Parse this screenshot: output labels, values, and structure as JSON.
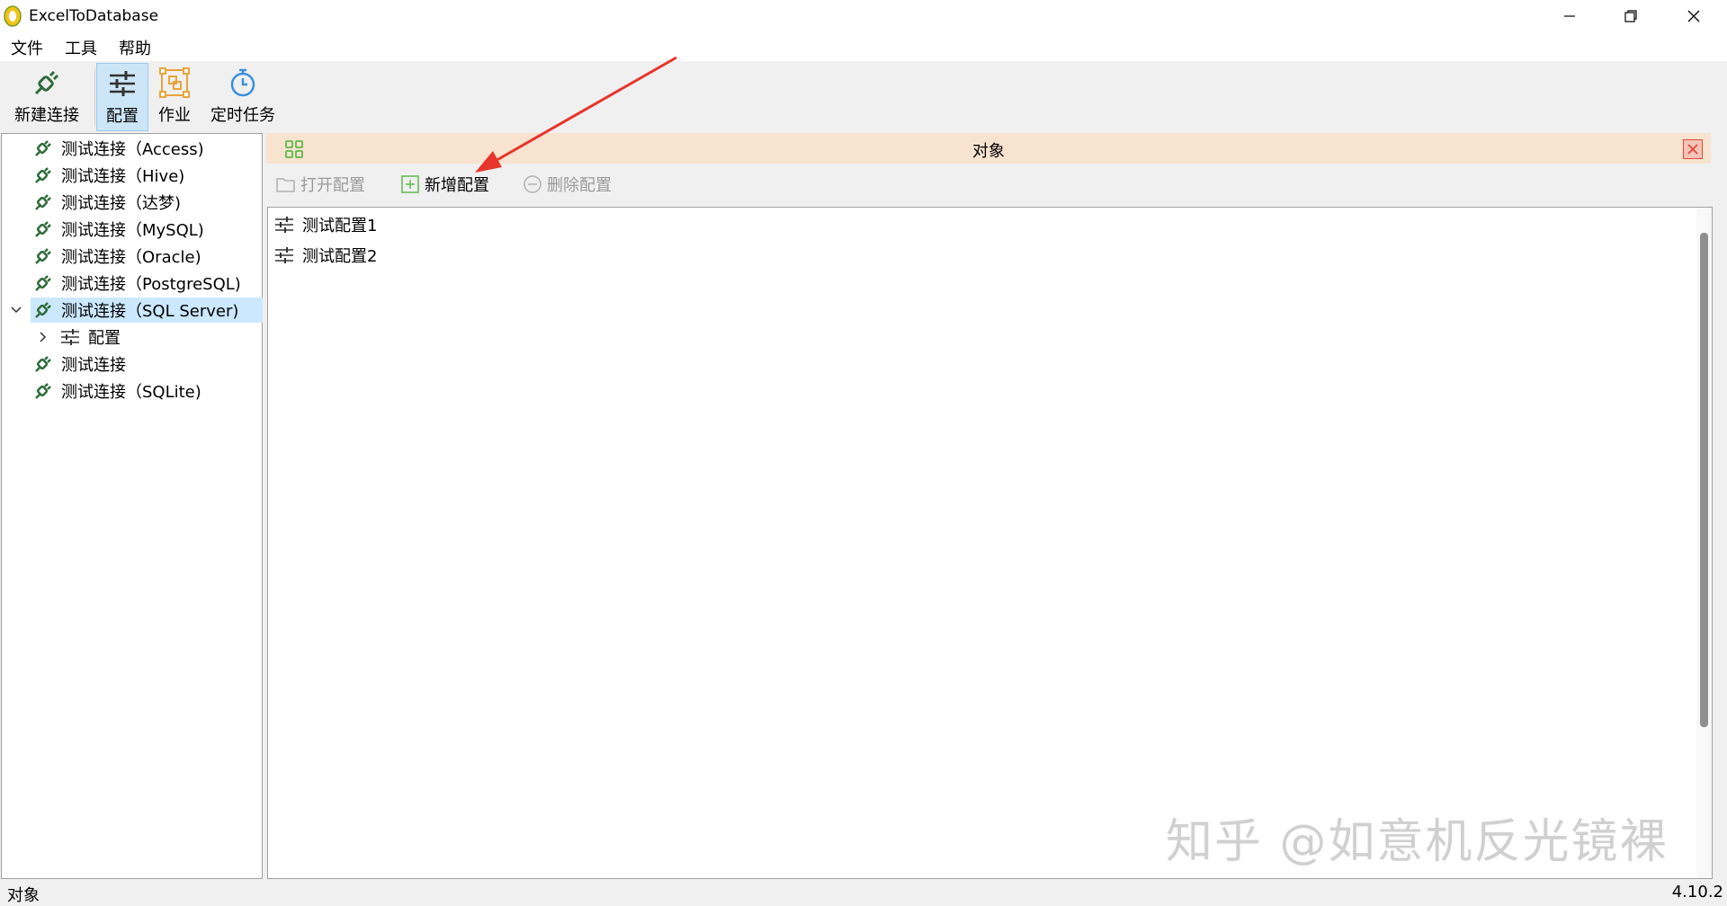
{
  "window": {
    "title": "ExcelToDatabase"
  },
  "menu": {
    "items": [
      "文件",
      "工具",
      "帮助"
    ]
  },
  "toolbar": {
    "new_connection": "新建连接",
    "config": "配置",
    "job": "作业",
    "scheduled_task": "定时任务"
  },
  "tree": {
    "items": [
      {
        "label": "测试连接（Access)"
      },
      {
        "label": "测试连接（Hive)"
      },
      {
        "label": "测试连接（达梦)"
      },
      {
        "label": "测试连接（MySQL)"
      },
      {
        "label": "测试连接（Oracle)"
      },
      {
        "label": "测试连接（PostgreSQL)"
      },
      {
        "label": "测试连接（SQL Server)"
      },
      {
        "label": "配置"
      },
      {
        "label": "测试连接"
      },
      {
        "label": "测试连接（SQLite)"
      }
    ]
  },
  "panel": {
    "title": "对象",
    "open_config": "打开配置",
    "new_config": "新增配置",
    "delete_config": "删除配置",
    "items": [
      {
        "label": "测试配置1"
      },
      {
        "label": "测试配置2"
      }
    ]
  },
  "status": {
    "left": "对象",
    "version": "4.10.2"
  },
  "watermark": "知乎 @如意机反光镜裸",
  "colors": {
    "connection_icon": "#2e6b3a",
    "accent_blue": "#3a8fd9",
    "job_orange": "#e8a43a",
    "panel_header": "#f7e3cf",
    "arrow": "#e8342a"
  }
}
